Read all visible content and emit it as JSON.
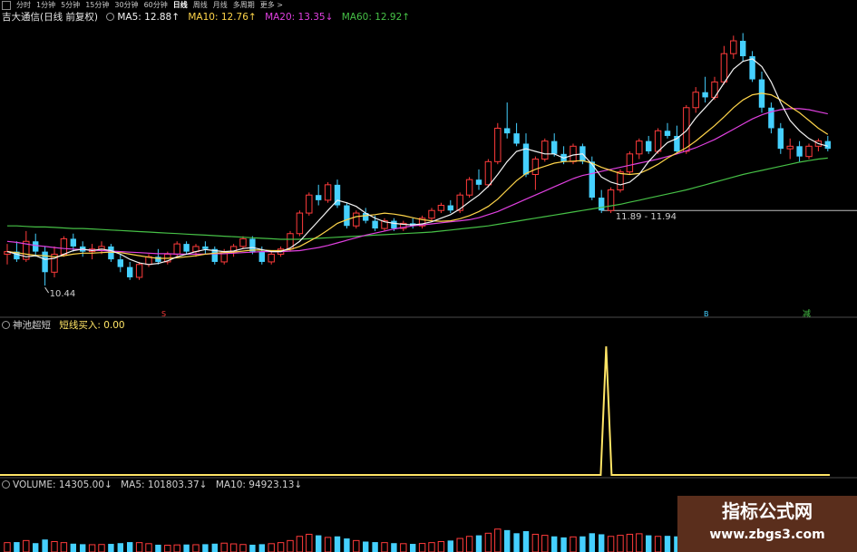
{
  "toolbar": {
    "periods": [
      "分时",
      "1分钟",
      "5分钟",
      "15分钟",
      "30分钟",
      "60分钟",
      "日线",
      "周线",
      "月线",
      "多周期",
      "更多 >"
    ],
    "active_period": "日线"
  },
  "main_legend": {
    "stock_name": "吉大通信(日线 前复权)",
    "ma5": "MA5: 12.88↑",
    "ma10": "MA10: 12.76↑",
    "ma20": "MA20: 13.35↓",
    "ma60": "MA60: 12.92↑"
  },
  "indicator_legend": {
    "name": "神池超短",
    "value": "短线买入: 0.00"
  },
  "volume_legend": {
    "volume": "VOLUME: 14305.00↓",
    "ma5": "MA5: 101803.37↓",
    "ma10": "MA10: 94923.13↓"
  },
  "annotations": {
    "low_label": "10.44",
    "level_label": "11.89 - 11.94",
    "marker_s": "S",
    "marker_b": "B",
    "marker_sell": "减"
  },
  "watermark": {
    "line1": "指标公式网",
    "line2": "www.zbgs3.com"
  },
  "colors": {
    "background": "#000000",
    "up": "#ff3b3b",
    "down": "#45d0ff",
    "ma5": "#f2f2f2",
    "ma10": "#ffd54a",
    "ma20": "#e040e0",
    "ma60": "#46c046",
    "signal": "#ffe566",
    "watermark_bg": "#5a2e1c"
  },
  "chart_data": [
    {
      "type": "candlestick",
      "title": "吉大通信(日线 前复权)",
      "ylim": [
        10.0,
        15.5
      ],
      "candles": [
        [
          11.05,
          11.25,
          10.85,
          11.1
        ],
        [
          11.1,
          11.3,
          10.9,
          10.95
        ],
        [
          10.95,
          11.5,
          10.9,
          11.3
        ],
        [
          11.3,
          11.45,
          11.0,
          11.1
        ],
        [
          11.1,
          11.2,
          10.44,
          10.7
        ],
        [
          10.7,
          11.2,
          10.6,
          11.05
        ],
        [
          11.05,
          11.4,
          11.0,
          11.35
        ],
        [
          11.35,
          11.45,
          11.1,
          11.2
        ],
        [
          11.2,
          11.3,
          11.0,
          11.1
        ],
        [
          11.1,
          11.25,
          10.95,
          11.15
        ],
        [
          11.15,
          11.3,
          11.05,
          11.2
        ],
        [
          11.2,
          11.25,
          10.9,
          10.95
        ],
        [
          10.95,
          11.05,
          10.7,
          10.8
        ],
        [
          10.8,
          10.9,
          10.55,
          10.6
        ],
        [
          10.6,
          10.9,
          10.55,
          10.85
        ],
        [
          10.85,
          11.05,
          10.8,
          11.0
        ],
        [
          11.0,
          11.15,
          10.85,
          10.9
        ],
        [
          10.9,
          11.1,
          10.85,
          11.05
        ],
        [
          11.05,
          11.3,
          11.0,
          11.25
        ],
        [
          11.25,
          11.3,
          11.05,
          11.1
        ],
        [
          11.1,
          11.25,
          11.0,
          11.2
        ],
        [
          11.2,
          11.3,
          11.05,
          11.15
        ],
        [
          11.15,
          11.2,
          10.85,
          10.9
        ],
        [
          10.9,
          11.15,
          10.85,
          11.1
        ],
        [
          11.1,
          11.25,
          11.0,
          11.2
        ],
        [
          11.2,
          11.4,
          11.15,
          11.35
        ],
        [
          11.35,
          11.4,
          11.05,
          11.1
        ],
        [
          11.1,
          11.2,
          10.85,
          10.9
        ],
        [
          10.9,
          11.1,
          10.85,
          11.05
        ],
        [
          11.05,
          11.2,
          11.0,
          11.15
        ],
        [
          11.15,
          11.5,
          11.1,
          11.45
        ],
        [
          11.45,
          11.9,
          11.4,
          11.85
        ],
        [
          11.85,
          12.25,
          11.8,
          12.2
        ],
        [
          12.2,
          12.4,
          12.0,
          12.1
        ],
        [
          12.1,
          12.45,
          12.05,
          12.4
        ],
        [
          12.4,
          12.5,
          11.95,
          12.0
        ],
        [
          12.0,
          12.05,
          11.55,
          11.6
        ],
        [
          11.6,
          11.9,
          11.55,
          11.85
        ],
        [
          11.85,
          11.95,
          11.65,
          11.7
        ],
        [
          11.7,
          11.8,
          11.5,
          11.55
        ],
        [
          11.55,
          11.75,
          11.5,
          11.7
        ],
        [
          11.7,
          11.75,
          11.5,
          11.55
        ],
        [
          11.55,
          11.7,
          11.5,
          11.65
        ],
        [
          11.65,
          11.75,
          11.55,
          11.6
        ],
        [
          11.6,
          11.8,
          11.55,
          11.75
        ],
        [
          11.75,
          11.95,
          11.7,
          11.9
        ],
        [
          11.9,
          12.05,
          11.85,
          12.0
        ],
        [
          12.0,
          12.1,
          11.85,
          11.9
        ],
        [
          11.9,
          12.25,
          11.85,
          12.2
        ],
        [
          12.2,
          12.55,
          12.15,
          12.5
        ],
        [
          12.5,
          12.7,
          12.3,
          12.4
        ],
        [
          12.4,
          12.9,
          12.35,
          12.85
        ],
        [
          12.85,
          13.6,
          12.8,
          13.5
        ],
        [
          13.5,
          14.0,
          13.3,
          13.4
        ],
        [
          13.4,
          13.6,
          13.15,
          13.2
        ],
        [
          13.2,
          13.4,
          12.55,
          12.6
        ],
        [
          12.6,
          12.95,
          12.3,
          12.9
        ],
        [
          12.9,
          13.3,
          12.85,
          13.25
        ],
        [
          13.25,
          13.4,
          12.95,
          13.0
        ],
        [
          13.0,
          13.15,
          12.8,
          12.85
        ],
        [
          12.85,
          13.2,
          12.8,
          13.15
        ],
        [
          13.15,
          13.2,
          12.8,
          12.85
        ],
        [
          12.85,
          12.95,
          12.1,
          12.15
        ],
        [
          12.15,
          12.3,
          11.85,
          11.9
        ],
        [
          11.9,
          12.35,
          11.85,
          12.3
        ],
        [
          12.3,
          12.7,
          12.25,
          12.65
        ],
        [
          12.65,
          13.05,
          12.6,
          13.0
        ],
        [
          13.0,
          13.3,
          12.9,
          13.25
        ],
        [
          13.25,
          13.35,
          13.0,
          13.05
        ],
        [
          13.05,
          13.5,
          13.0,
          13.45
        ],
        [
          13.45,
          13.6,
          13.3,
          13.35
        ],
        [
          13.35,
          13.55,
          13.0,
          13.05
        ],
        [
          13.05,
          13.95,
          13.0,
          13.9
        ],
        [
          13.9,
          14.3,
          13.8,
          14.2
        ],
        [
          14.2,
          14.5,
          14.0,
          14.1
        ],
        [
          14.1,
          14.5,
          14.05,
          14.4
        ],
        [
          14.4,
          15.1,
          14.35,
          14.95
        ],
        [
          14.95,
          15.3,
          14.85,
          15.2
        ],
        [
          15.2,
          15.35,
          14.8,
          14.9
        ],
        [
          14.9,
          15.0,
          14.4,
          14.45
        ],
        [
          14.45,
          14.6,
          13.8,
          13.9
        ],
        [
          13.9,
          14.0,
          13.4,
          13.5
        ],
        [
          13.5,
          13.6,
          13.0,
          13.1
        ],
        [
          13.1,
          13.3,
          12.9,
          13.15
        ],
        [
          13.15,
          13.25,
          12.85,
          12.95
        ],
        [
          12.95,
          13.2,
          12.9,
          13.15
        ],
        [
          13.15,
          13.3,
          13.05,
          13.25
        ],
        [
          13.25,
          13.35,
          13.05,
          13.1
        ]
      ],
      "ma5": [
        11.1,
        11.05,
        11.0,
        11.02,
        10.95,
        10.97,
        11.05,
        11.12,
        11.15,
        11.12,
        11.15,
        11.12,
        11.05,
        10.95,
        10.88,
        10.85,
        10.87,
        10.92,
        11.0,
        11.05,
        11.1,
        11.14,
        11.12,
        11.1,
        11.11,
        11.16,
        11.18,
        11.14,
        11.1,
        11.1,
        11.17,
        11.3,
        11.5,
        11.7,
        11.9,
        12.1,
        12.05,
        11.98,
        11.85,
        11.75,
        11.68,
        11.65,
        11.63,
        11.62,
        11.64,
        11.68,
        11.75,
        11.82,
        11.93,
        12.07,
        12.2,
        12.37,
        12.6,
        12.85,
        13.05,
        13.1,
        13.05,
        13.0,
        13.0,
        12.92,
        12.98,
        13.0,
        12.8,
        12.55,
        12.45,
        12.4,
        12.45,
        12.6,
        12.85,
        13.05,
        13.22,
        13.3,
        13.45,
        13.7,
        13.9,
        14.1,
        14.38,
        14.65,
        14.8,
        14.85,
        14.7,
        14.4,
        14.0,
        13.65,
        13.45,
        13.3,
        13.2,
        13.15
      ],
      "ma10": [
        11.1,
        11.08,
        11.05,
        11.03,
        11.02,
        11.0,
        11.02,
        11.05,
        11.07,
        11.07,
        11.08,
        11.09,
        11.08,
        11.05,
        11.02,
        10.99,
        10.97,
        10.97,
        10.98,
        11.0,
        11.02,
        11.05,
        11.07,
        11.08,
        11.09,
        11.11,
        11.13,
        11.13,
        11.12,
        11.12,
        11.14,
        11.2,
        11.3,
        11.4,
        11.52,
        11.65,
        11.72,
        11.78,
        11.8,
        11.82,
        11.85,
        11.83,
        11.8,
        11.76,
        11.72,
        11.7,
        11.69,
        11.7,
        11.74,
        11.8,
        11.88,
        11.98,
        12.12,
        12.3,
        12.48,
        12.62,
        12.7,
        12.76,
        12.82,
        12.85,
        12.86,
        12.87,
        12.82,
        12.74,
        12.68,
        12.62,
        12.6,
        12.62,
        12.7,
        12.8,
        12.92,
        13.02,
        13.12,
        13.25,
        13.4,
        13.55,
        13.72,
        13.9,
        14.05,
        14.15,
        14.18,
        14.15,
        14.05,
        13.92,
        13.8,
        13.65,
        13.5,
        13.38
      ],
      "ma20": [
        11.3,
        11.28,
        11.25,
        11.22,
        11.2,
        11.18,
        11.16,
        11.15,
        11.14,
        11.13,
        11.12,
        11.11,
        11.1,
        11.09,
        11.08,
        11.07,
        11.06,
        11.06,
        11.05,
        11.05,
        11.05,
        11.05,
        11.06,
        11.06,
        11.07,
        11.08,
        11.09,
        11.1,
        11.1,
        11.1,
        11.11,
        11.12,
        11.15,
        11.18,
        11.22,
        11.27,
        11.32,
        11.37,
        11.42,
        11.46,
        11.5,
        11.54,
        11.57,
        11.6,
        11.62,
        11.64,
        11.66,
        11.68,
        11.7,
        11.72,
        11.76,
        11.82,
        11.88,
        11.96,
        12.04,
        12.12,
        12.2,
        12.28,
        12.36,
        12.44,
        12.52,
        12.58,
        12.62,
        12.66,
        12.7,
        12.74,
        12.78,
        12.82,
        12.86,
        12.9,
        12.95,
        13.0,
        13.06,
        13.12,
        13.2,
        13.28,
        13.38,
        13.48,
        13.58,
        13.68,
        13.76,
        13.82,
        13.86,
        13.88,
        13.88,
        13.86,
        13.82,
        13.78
      ],
      "ma60": [
        11.6,
        11.6,
        11.59,
        11.58,
        11.58,
        11.57,
        11.56,
        11.55,
        11.55,
        11.54,
        11.53,
        11.52,
        11.51,
        11.5,
        11.49,
        11.48,
        11.47,
        11.46,
        11.45,
        11.44,
        11.43,
        11.42,
        11.41,
        11.4,
        11.39,
        11.38,
        11.37,
        11.36,
        11.35,
        11.34,
        11.34,
        11.34,
        11.35,
        11.36,
        11.37,
        11.38,
        11.39,
        11.4,
        11.41,
        11.42,
        11.43,
        11.44,
        11.45,
        11.46,
        11.47,
        11.48,
        11.5,
        11.52,
        11.54,
        11.56,
        11.58,
        11.6,
        11.63,
        11.66,
        11.69,
        11.72,
        11.75,
        11.78,
        11.81,
        11.84,
        11.87,
        11.9,
        11.93,
        11.96,
        11.99,
        12.02,
        12.06,
        12.1,
        12.14,
        12.18,
        12.22,
        12.26,
        12.3,
        12.35,
        12.4,
        12.45,
        12.5,
        12.55,
        12.6,
        12.64,
        12.68,
        12.72,
        12.76,
        12.8,
        12.84,
        12.87,
        12.9,
        12.92
      ],
      "low_point": {
        "index": 4,
        "value": 10.44
      },
      "level_line": {
        "start_index": 63,
        "value": 11.9
      }
    },
    {
      "type": "line",
      "title": "神池超短",
      "series": [
        {
          "name": "短线买入",
          "values": [
            0,
            0,
            0,
            0,
            0,
            0,
            0,
            0,
            0,
            0,
            0,
            0,
            0,
            0,
            0,
            0,
            0,
            0,
            0,
            0,
            0,
            0,
            0,
            0,
            0,
            0,
            0,
            0,
            0,
            0,
            0,
            0,
            0,
            0,
            0,
            0,
            0,
            0,
            0,
            0,
            0,
            0,
            0,
            0,
            0,
            0,
            0,
            0,
            0,
            0,
            0,
            0,
            0,
            0,
            0,
            0,
            0,
            0,
            0,
            0,
            0,
            0,
            0,
            0,
            0,
            0,
            0,
            0,
            0,
            0,
            0,
            0,
            0,
            0,
            0,
            0,
            0,
            0,
            0,
            0,
            0,
            0,
            0,
            0,
            0,
            0,
            0,
            0
          ]
        }
      ],
      "spikes": [
        {
          "index": 63.5,
          "value": 100
        }
      ],
      "ylim": [
        0,
        110
      ]
    },
    {
      "type": "bar",
      "title": "VOLUME",
      "values": [
        90000,
        95000,
        110000,
        85000,
        120000,
        100000,
        90000,
        80000,
        75000,
        70000,
        72000,
        78000,
        85000,
        95000,
        90000,
        80000,
        70000,
        65000,
        68000,
        72000,
        70000,
        75000,
        80000,
        85000,
        78000,
        72000,
        70000,
        75000,
        80000,
        90000,
        110000,
        150000,
        170000,
        160000,
        140000,
        150000,
        130000,
        110000,
        100000,
        95000,
        90000,
        85000,
        80000,
        78000,
        82000,
        90000,
        100000,
        110000,
        130000,
        150000,
        160000,
        180000,
        220000,
        210000,
        180000,
        200000,
        170000,
        160000,
        150000,
        140000,
        145000,
        150000,
        180000,
        170000,
        150000,
        160000,
        170000,
        175000,
        160000,
        150000,
        155000,
        150000,
        170000,
        190000,
        180000,
        175000,
        200000,
        210000,
        190000,
        180000,
        170000,
        150000,
        130000,
        120000,
        110000,
        105000,
        100000,
        14305
      ],
      "ylim": [
        0,
        600000
      ]
    }
  ]
}
